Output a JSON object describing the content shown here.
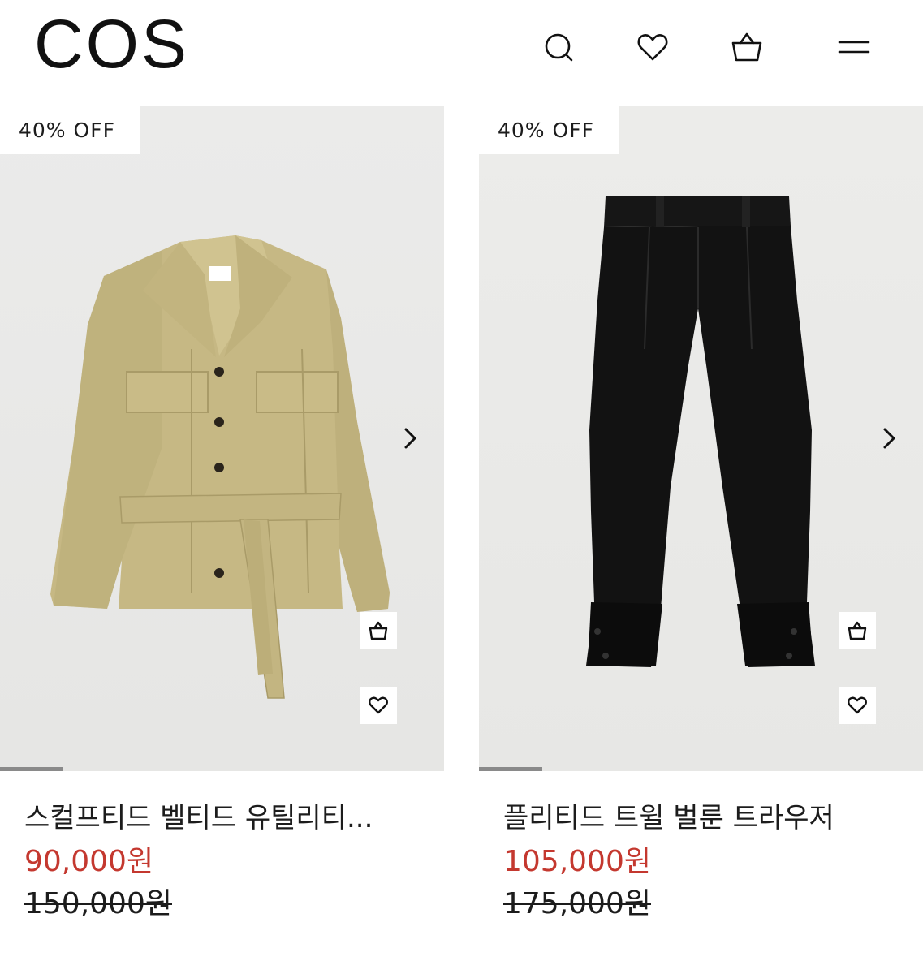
{
  "header": {
    "logo": "COS",
    "icons": [
      "search-icon",
      "heart-icon",
      "shopping-bag-icon",
      "menu-icon"
    ]
  },
  "products": [
    {
      "badge": "40% OFF",
      "name": "스컬프티드 벨티드 유틸리티...",
      "sale_price": "90,000원",
      "original_price": "150,000원",
      "image_colors": {
        "garment": "#c3b582",
        "background": "#e9e9e7"
      },
      "carousel_progress": 0.14
    },
    {
      "badge": "40% OFF",
      "name": "플리티드 트윌 벌룬 트라우저",
      "sale_price": "105,000원",
      "original_price": "175,000원",
      "image_colors": {
        "garment": "#121212",
        "background": "#e9e9e7"
      },
      "carousel_progress": 0.14
    }
  ],
  "colors": {
    "sale": "#c4382f",
    "text": "#1c1c1c"
  }
}
